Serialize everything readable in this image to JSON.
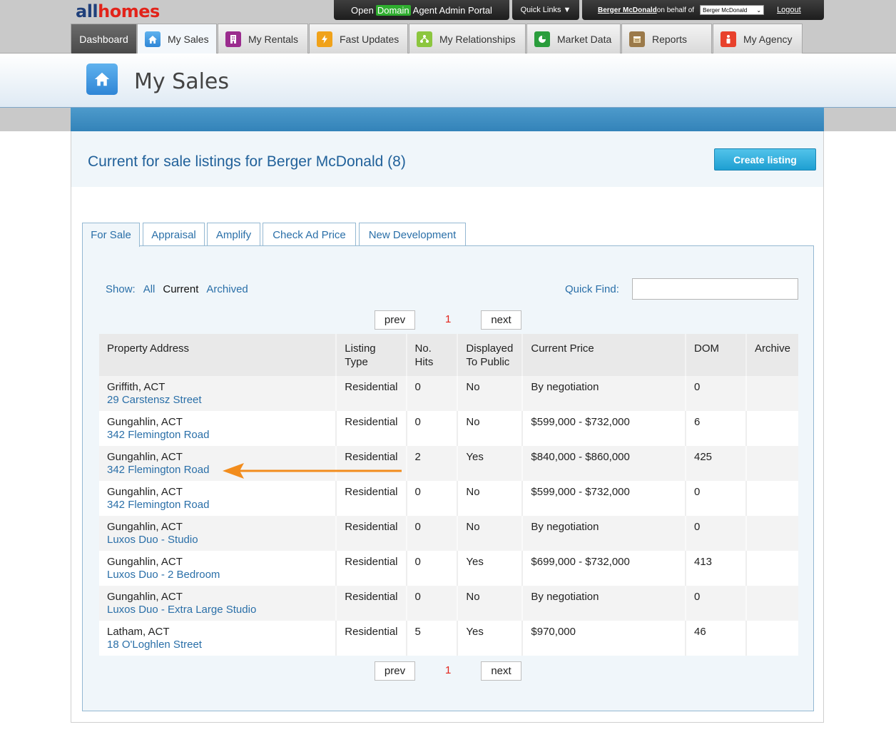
{
  "header": {
    "logo_part1": "all",
    "logo_part2": "homes",
    "portal_open": "Open",
    "portal_domain": "Domain",
    "portal_rest": "Agent Admin Portal",
    "quick_links": "Quick Links ▼",
    "user_name": "Berger McDonald",
    "on_behalf_text": " on behalf of",
    "agency_selected": "Berger McDonald",
    "logout": "Logout"
  },
  "nav": {
    "dashboard": "Dashboard",
    "my_sales": "My Sales",
    "my_rentals": "My Rentals",
    "fast_updates": "Fast Updates",
    "my_relationships": "My Relationships",
    "market_data": "Market Data",
    "reports": "Reports",
    "my_agency": "My Agency"
  },
  "page": {
    "title": "My Sales",
    "list_title": "Current for sale listings for Berger McDonald (8)",
    "create_listing": "Create listing"
  },
  "subtabs": {
    "for_sale": "For Sale",
    "appraisal": "Appraisal",
    "amplify": "Amplify",
    "check_ad_price": "Check Ad Price",
    "new_development": "New Development"
  },
  "filters": {
    "show_label": "Show:",
    "all": "All",
    "current": "Current",
    "archived": "Archived",
    "quick_find_label": "Quick Find:",
    "quick_find_value": ""
  },
  "pager": {
    "prev": "prev",
    "page": "1",
    "next": "next"
  },
  "table": {
    "headers": {
      "address": "Property Address",
      "type_line1": "Listing",
      "type_line2": "Type",
      "hits_line1": "No.",
      "hits_line2": "Hits",
      "displayed_line1": "Displayed",
      "displayed_line2": "To Public",
      "price": "Current Price",
      "dom": "DOM",
      "archive": "Archive"
    },
    "rows": [
      {
        "suburb": "Griffith, ACT",
        "address": "29 Carstensz Street",
        "type": "Residential",
        "hits": "0",
        "displayed": "No",
        "price": "By negotiation",
        "dom": "0"
      },
      {
        "suburb": "Gungahlin, ACT",
        "address": "342 Flemington Road",
        "type": "Residential",
        "hits": "0",
        "displayed": "No",
        "price": "$599,000 - $732,000",
        "dom": "6"
      },
      {
        "suburb": "Gungahlin, ACT",
        "address": "342 Flemington Road",
        "type": "Residential",
        "hits": "2",
        "displayed": "Yes",
        "price": "$840,000 - $860,000",
        "dom": "425"
      },
      {
        "suburb": "Gungahlin, ACT",
        "address": "342 Flemington Road",
        "type": "Residential",
        "hits": "0",
        "displayed": "No",
        "price": "$599,000 - $732,000",
        "dom": "0"
      },
      {
        "suburb": "Gungahlin, ACT",
        "address": "Luxos Duo - Studio",
        "type": "Residential",
        "hits": "0",
        "displayed": "No",
        "price": "By negotiation",
        "dom": "0"
      },
      {
        "suburb": "Gungahlin, ACT",
        "address": "Luxos Duo - 2 Bedroom",
        "type": "Residential",
        "hits": "0",
        "displayed": "Yes",
        "price": "$699,000 - $732,000",
        "dom": "413"
      },
      {
        "suburb": "Gungahlin, ACT",
        "address": "Luxos Duo - Extra Large Studio",
        "type": "Residential",
        "hits": "0",
        "displayed": "No",
        "price": "By negotiation",
        "dom": "0"
      },
      {
        "suburb": "Latham, ACT",
        "address": "18 O'Loghlen Street",
        "type": "Residential",
        "hits": "5",
        "displayed": "Yes",
        "price": "$970,000",
        "dom": "46"
      }
    ]
  },
  "colors": {
    "accent_blue": "#2a6fa8",
    "create_button": "#1e9fd2",
    "annotation_arrow": "#f28c1c",
    "page_number": "#e2231a"
  }
}
